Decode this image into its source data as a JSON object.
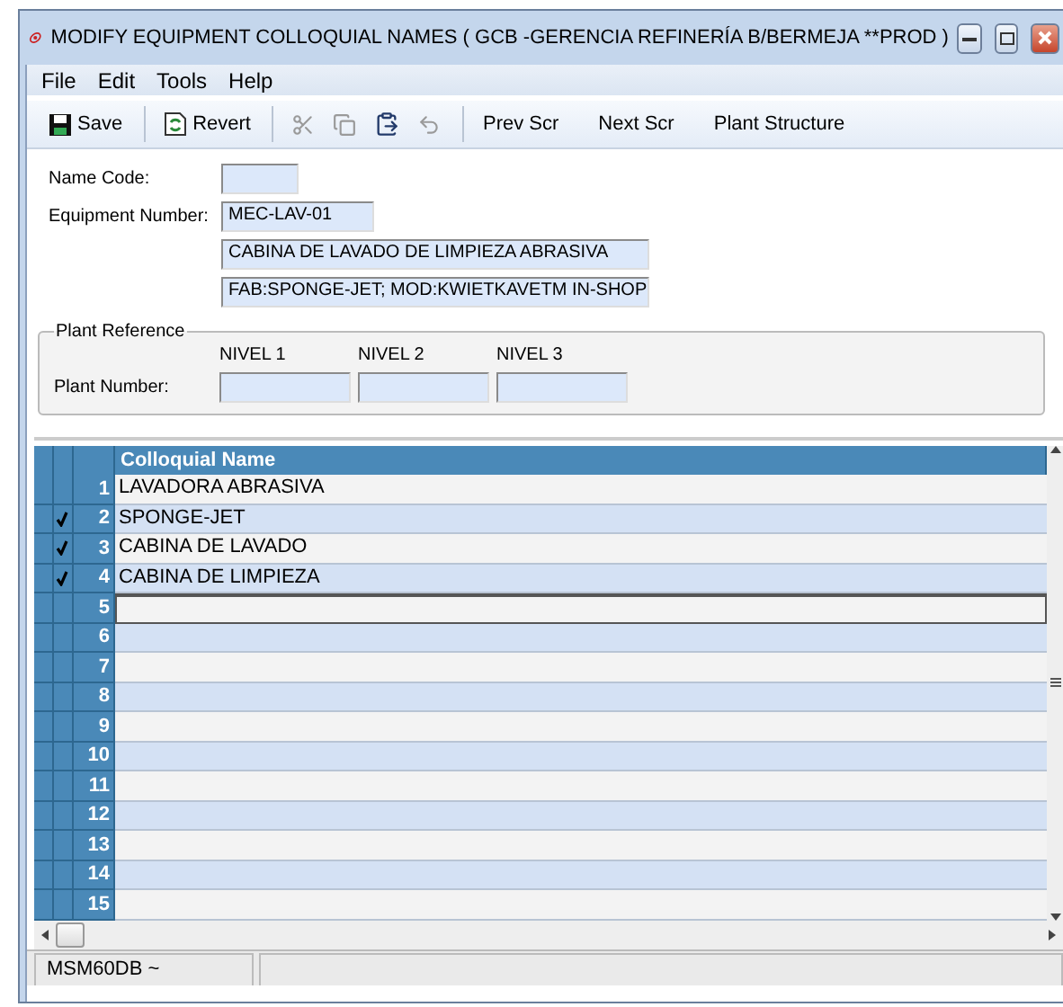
{
  "window": {
    "title": "MODIFY EQUIPMENT COLLOQUIAL NAMES ( GCB -GERENCIA REFINERÍA B/BERMEJA **PROD )"
  },
  "menu": [
    "File",
    "Edit",
    "Tools",
    "Help"
  ],
  "toolbar": [
    {
      "kind": "save",
      "label": "Save",
      "disabled": false
    },
    {
      "kind": "revert",
      "label": "Revert",
      "disabled": false
    },
    {
      "kind": "cut",
      "disabled": true
    },
    {
      "kind": "copy",
      "disabled": true
    },
    {
      "kind": "paste",
      "disabled": false
    },
    {
      "kind": "undo",
      "disabled": true
    },
    {
      "kind": "text",
      "label": "Prev Scr",
      "disabled": false
    },
    {
      "kind": "text",
      "label": "Next Scr",
      "disabled": false
    },
    {
      "kind": "text",
      "label": "Plant Structure",
      "disabled": false
    }
  ],
  "form": {
    "name_code": {
      "label": "Name Code:"
    },
    "equipment_number": {
      "label": "Equipment Number:",
      "value": "MEC-LAV-01"
    },
    "description_1": "CABINA DE LAVADO DE LIMPIEZA ABRASIVA",
    "description_2": "FAB:SPONGE-JET; MOD:KWIETKAVETM IN-SHOP"
  },
  "plant_reference": {
    "title": "Plant Reference",
    "row_label": "Plant Number:",
    "levels": [
      {
        "label": "NIVEL 1"
      },
      {
        "label": "NIVEL 2"
      },
      {
        "label": "NIVEL 3"
      }
    ]
  },
  "table": {
    "columns": [
      "Colloquial Name"
    ],
    "rows": [
      {
        "number": "1",
        "name": "LAVADORA ABRASIVA",
        "checked": false,
        "current": false
      },
      {
        "number": "2",
        "name": "SPONGE-JET",
        "checked": true,
        "current": false
      },
      {
        "number": "3",
        "name": "CABINA DE LAVADO",
        "checked": true,
        "current": false
      },
      {
        "number": "4",
        "name": "CABINA DE LIMPIEZA",
        "checked": true,
        "current": false
      },
      {
        "number": "5",
        "name": "",
        "checked": false,
        "current": true
      },
      {
        "number": "6",
        "name": "",
        "checked": false,
        "current": false
      },
      {
        "number": "7",
        "name": "",
        "checked": false,
        "current": false
      },
      {
        "number": "8",
        "name": "",
        "checked": false,
        "current": false
      },
      {
        "number": "9",
        "name": "",
        "checked": false,
        "current": false
      },
      {
        "number": "10",
        "name": "",
        "checked": false,
        "current": false
      },
      {
        "number": "11",
        "name": "",
        "checked": false,
        "current": false
      },
      {
        "number": "12",
        "name": "",
        "checked": false,
        "current": false
      },
      {
        "number": "13",
        "name": "",
        "checked": false,
        "current": false
      },
      {
        "number": "14",
        "name": "",
        "checked": false,
        "current": false
      },
      {
        "number": "15",
        "name": "",
        "checked": false,
        "current": false
      }
    ]
  },
  "status_bar": [
    "MSM60DB ~"
  ]
}
